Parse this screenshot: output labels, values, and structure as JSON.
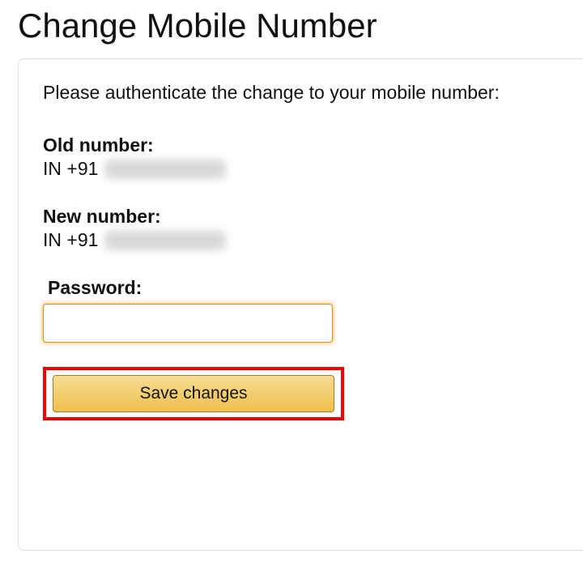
{
  "title": "Change Mobile Number",
  "instruction": "Please authenticate the change to your mobile number:",
  "old_number": {
    "label": "Old number:",
    "prefix": "IN +91"
  },
  "new_number": {
    "label": "New number:",
    "prefix": "IN +91"
  },
  "password": {
    "label": "Password:",
    "value": ""
  },
  "save_button_label": "Save changes"
}
